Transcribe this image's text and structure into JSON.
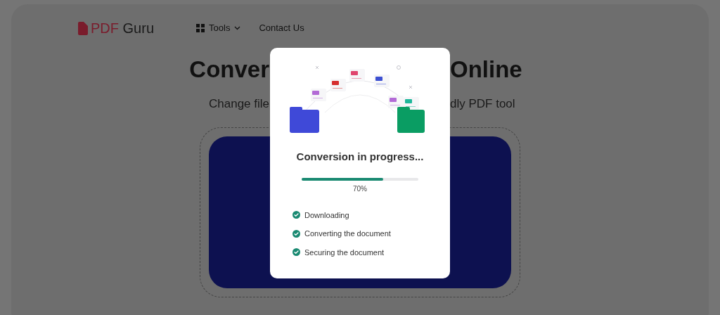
{
  "header": {
    "logo": {
      "part_1": "PDF",
      "part_2": "Guru"
    },
    "nav": [
      {
        "label": "Tools",
        "kind": "dropdown"
      },
      {
        "label": "Contact Us",
        "kind": "link"
      }
    ]
  },
  "hero": {
    "title_left": "Conver",
    "title_right": "Online",
    "subtitle_left": "Change file",
    "subtitle_right": "dly PDF tool"
  },
  "modal": {
    "title": "Conversion in progress...",
    "progress": {
      "level": 0.7,
      "reading": "70%"
    },
    "steps": [
      {
        "label": "Downloading",
        "done": true
      },
      {
        "label": "Converting the document",
        "done": true
      },
      {
        "label": "Securing the document",
        "done": true
      }
    ]
  }
}
